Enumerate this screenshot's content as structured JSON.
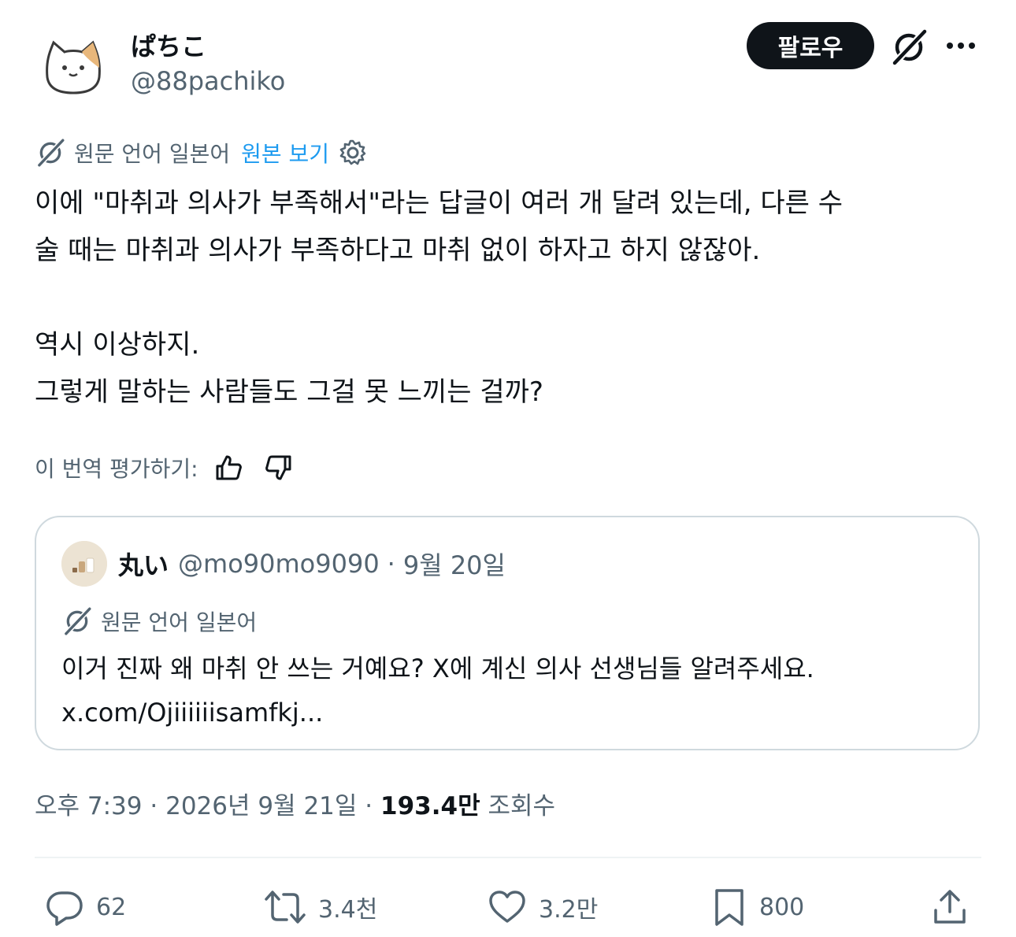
{
  "author": {
    "display_name": "ぱちこ",
    "handle": "@88pachiko",
    "avatar": "cat-avatar"
  },
  "follow_label": "팔로우",
  "translation": {
    "source_label": "원문 언어 일본어",
    "view_original_label": "원본 보기"
  },
  "body": {
    "line1": "이에 \"마취과 의사가 부족해서\"라는 답글이 여러 개 달려 있는데, 다른 수",
    "line2": "술 때는 마취과 의사가 부족하다고 마취 없이 하자고 하지 않잖아.",
    "line3": "역시 이상하지.",
    "line4": "그렇게 말하는 사람들도 그걸 못 느끼는 걸까?"
  },
  "rate_label": "이 번역 평가하기:",
  "quote": {
    "name": "丸い",
    "handle": "@mo90mo9090",
    "separator": "·",
    "date": "9월 20일",
    "translation_label": "원문 언어 일본어",
    "line1": "이거 진짜 왜 마취 안 쓰는 거예요? X에 계신 의사 선생님들 알려주세요.",
    "line2": "x.com/Ojiiiiiisamfkj..."
  },
  "meta": {
    "time": "오후 7:39",
    "sep1": "·",
    "date": "2026년 9월 21일",
    "sep2": "·",
    "views": "193.4만",
    "views_label": "조회수"
  },
  "actions": {
    "replies": "62",
    "reposts": "3.4천",
    "likes": "3.2만",
    "bookmarks": "800"
  },
  "colors": {
    "text": "#0f1419",
    "secondary": "#536471",
    "link": "#1d9bf0",
    "border": "#cfd9de"
  }
}
